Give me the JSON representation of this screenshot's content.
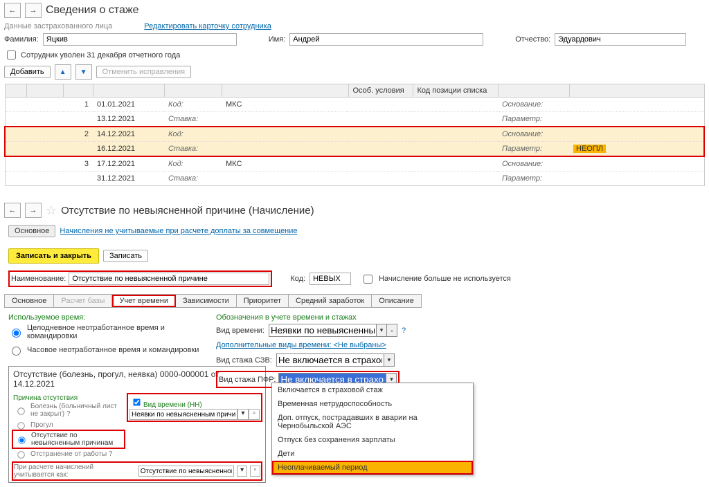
{
  "header": {
    "title": "Сведения о стаже",
    "insured_label": "Данные застрахованного лица",
    "edit_card": "Редактировать карточку сотрудника",
    "surname_label": "Фамилия:",
    "surname": "Яцкив",
    "name_label": "Имя:",
    "name": "Андрей",
    "patronymic_label": "Отчество:",
    "patronymic": "Эдуардович",
    "fired_label": " Сотрудник уволен 31 декабря отчетного года",
    "add_btn": "Добавить",
    "cancel_fix": "Отменить исправления"
  },
  "table": {
    "col_special": "Особ. условия",
    "col_position": "Код позиции списка",
    "rows": [
      {
        "n": "1",
        "d1": "01.01.2021",
        "k": "Код:",
        "v": "МКС",
        "b": "Основание:"
      },
      {
        "n": "",
        "d1": "13.12.2021",
        "k": "Ставка:",
        "v": "",
        "b": "Параметр:"
      },
      {
        "n": "2",
        "d1": "14.12.2021",
        "k": "Код:",
        "v": "",
        "b": "Основание:",
        "sel": true,
        "out_top": true
      },
      {
        "n": "",
        "d1": "16.12.2021",
        "k": "Ставка:",
        "v": "",
        "b": "Параметр:",
        "bval": "НЕОПЛ",
        "sel": true,
        "out_bot": true
      },
      {
        "n": "3",
        "d1": "17.12.2021",
        "k": "Код:",
        "v": "МКС",
        "b": "Основание:"
      },
      {
        "n": "",
        "d1": "31.12.2021",
        "k": "Ставка:",
        "v": "",
        "b": "Параметр:"
      }
    ]
  },
  "calc": {
    "title": "Отсутствие по невыясненной причине (Начисление)",
    "main_link": "Основное",
    "exclusion_link": "Начисления не учитываемые при расчете доплаты за совмещение",
    "save_close": "Записать и закрыть",
    "save": "Записать",
    "name_label": "Наименование:",
    "name_value": "Отсутствие по невыясненной причине",
    "code_label": "Код:",
    "code_value": "НЕВЫХ",
    "not_used": " Начисление больше не используется"
  },
  "tabs": [
    "Основное",
    "Расчет базы",
    "Учет времени",
    "Зависимости",
    "Приоритет",
    "Средний заработок",
    "Описание"
  ],
  "time": {
    "used_label": "Используемое время:",
    "opt_full": "Целодневное неотработанное время и командировки",
    "opt_hour": "Часовое неотработанное время и командировки",
    "designations": "Обозначения в учете времени и стажах",
    "kind_label": "Вид времени:",
    "kind_value": "Неявки по невыясненным",
    "additional": "Дополнительные виды времени: <Не выбраны>",
    "szv_label": "Вид стажа СЗВ:",
    "szv_value": "Не включается в страхов",
    "pfr_label": "Вид стажа ПФР:",
    "pfr_value": "Не включается в страхов",
    "dd": [
      "Включается в страховой стаж",
      "Временная нетрудоспособность",
      "Доп. отпуск, пострадавших в аварии на Чернобыльской АЭС",
      "Отпуск без сохранения зарплаты",
      "Дети",
      "Неоплачиваемый период"
    ]
  },
  "miniform": {
    "title": "Отсутствие (болезнь, прогул, неявка) 0000-000001 от 14.12.2021",
    "reason_label": "Причина отсутствия",
    "r1": "Болезнь (больничный лист не закрыт) ?",
    "r2": "Прогул",
    "r3": "Отсутствие по невыясненным причинам",
    "r4": "Отстранение от работы ?",
    "kind_nn": "Вид времени (НН)",
    "kind_val": "Неявки по невыясненным причинам",
    "calc_as_label": "При расчете начислений учитывается как:",
    "calc_as_val": "Отсутствие по невыясненной причине"
  }
}
